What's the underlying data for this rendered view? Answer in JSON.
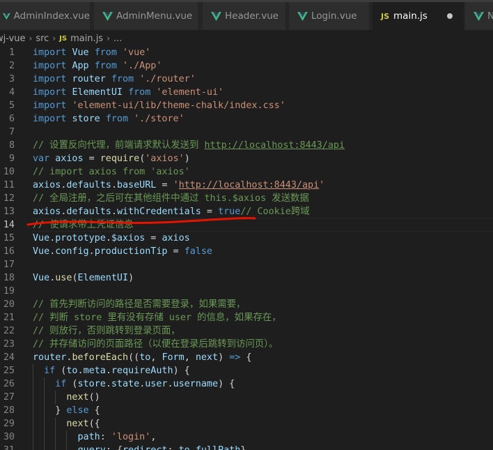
{
  "tabs": [
    {
      "label": "AdminIndex.vue",
      "icon": "vue-icon"
    },
    {
      "label": "AdminMenu.vue",
      "icon": "vue-icon"
    },
    {
      "label": "Header.vue",
      "icon": "vue-icon"
    },
    {
      "label": "Login.vue",
      "icon": "vue-icon"
    },
    {
      "label": "main.js",
      "icon": "js-icon",
      "active": true,
      "unsaved": true
    },
    {
      "label": "Nav",
      "icon": "vue-icon"
    }
  ],
  "js_badge": "JS",
  "breadcrumb": {
    "project": "wj-vue",
    "folder": "src",
    "file": "main.js",
    "more": "..."
  },
  "annotation": {
    "color": "#e51400",
    "description": "red hand-drawn underline under line 13"
  },
  "colors": {
    "keyword": "#569cd6",
    "string": "#ce9178",
    "comment": "#6a9955",
    "variable": "#9cdcfe",
    "function": "#dcdcaa",
    "plain": "#d4d4d4",
    "vue_icon": "#41b883"
  },
  "lines": [
    {
      "n": "1",
      "tokens": [
        [
          "import",
          "k"
        ],
        [
          " ",
          "p"
        ],
        [
          "Vue",
          "v"
        ],
        [
          " ",
          "p"
        ],
        [
          "from",
          "k"
        ],
        [
          " ",
          "p"
        ],
        [
          "'vue'",
          "s"
        ]
      ]
    },
    {
      "n": "2",
      "tokens": [
        [
          "import",
          "k"
        ],
        [
          " ",
          "p"
        ],
        [
          "App",
          "v"
        ],
        [
          " ",
          "p"
        ],
        [
          "from",
          "k"
        ],
        [
          " ",
          "p"
        ],
        [
          "'./App'",
          "s"
        ]
      ]
    },
    {
      "n": "3",
      "tokens": [
        [
          "import",
          "k"
        ],
        [
          " ",
          "p"
        ],
        [
          "router",
          "v"
        ],
        [
          " ",
          "p"
        ],
        [
          "from",
          "k"
        ],
        [
          " ",
          "p"
        ],
        [
          "'./router'",
          "s"
        ]
      ]
    },
    {
      "n": "4",
      "tokens": [
        [
          "import",
          "k"
        ],
        [
          " ",
          "p"
        ],
        [
          "ElementUI",
          "v"
        ],
        [
          " ",
          "p"
        ],
        [
          "from",
          "k"
        ],
        [
          " ",
          "p"
        ],
        [
          "'element-ui'",
          "s"
        ]
      ]
    },
    {
      "n": "5",
      "tokens": [
        [
          "import",
          "k"
        ],
        [
          " ",
          "p"
        ],
        [
          "'element-ui/lib/theme-chalk/index.css'",
          "s"
        ]
      ]
    },
    {
      "n": "6",
      "tokens": [
        [
          "import",
          "k"
        ],
        [
          " ",
          "p"
        ],
        [
          "store",
          "v"
        ],
        [
          " ",
          "p"
        ],
        [
          "from",
          "k"
        ],
        [
          " ",
          "p"
        ],
        [
          "'./store'",
          "s"
        ]
      ]
    },
    {
      "n": "7",
      "tokens": []
    },
    {
      "n": "8",
      "tokens": [
        [
          "// 设置反向代理，前端请求默认发送到 ",
          "c"
        ],
        [
          "http://localhost:8443/api",
          "c u"
        ]
      ]
    },
    {
      "n": "9",
      "tokens": [
        [
          "var",
          "k"
        ],
        [
          " ",
          "p"
        ],
        [
          "axios",
          "v"
        ],
        [
          " = ",
          "p"
        ],
        [
          "require",
          "f"
        ],
        [
          "(",
          "p"
        ],
        [
          "'axios'",
          "s"
        ],
        [
          ")",
          "p"
        ]
      ]
    },
    {
      "n": "10",
      "tokens": [
        [
          "// import axios from 'axios'",
          "c"
        ]
      ]
    },
    {
      "n": "11",
      "tokens": [
        [
          "axios",
          "v"
        ],
        [
          ".",
          "p"
        ],
        [
          "defaults",
          "v"
        ],
        [
          ".",
          "p"
        ],
        [
          "baseURL",
          "v"
        ],
        [
          " = ",
          "p"
        ],
        [
          "'",
          "s"
        ],
        [
          "http://localhost:8443/api",
          "s u"
        ],
        [
          "'",
          "s"
        ]
      ]
    },
    {
      "n": "12",
      "tokens": [
        [
          "// 全局注册，之后可在其他组件中通过 this.$axios 发送数据",
          "c"
        ]
      ]
    },
    {
      "n": "13",
      "tokens": [
        [
          "axios",
          "v"
        ],
        [
          ".",
          "p"
        ],
        [
          "defaults",
          "v"
        ],
        [
          ".",
          "p"
        ],
        [
          "withCredentials",
          "v"
        ],
        [
          " = ",
          "p"
        ],
        [
          "true",
          "k"
        ],
        [
          "// Cookie跨域",
          "c"
        ]
      ]
    },
    {
      "n": "14",
      "current": true,
      "tokens": [
        [
          "// 使请求带上凭证信息",
          "c"
        ]
      ]
    },
    {
      "n": "15",
      "tokens": [
        [
          "Vue",
          "v"
        ],
        [
          ".",
          "p"
        ],
        [
          "prototype",
          "v"
        ],
        [
          ".",
          "p"
        ],
        [
          "$axios",
          "v"
        ],
        [
          " = ",
          "p"
        ],
        [
          "axios",
          "v"
        ]
      ]
    },
    {
      "n": "16",
      "tokens": [
        [
          "Vue",
          "v"
        ],
        [
          ".",
          "p"
        ],
        [
          "config",
          "v"
        ],
        [
          ".",
          "p"
        ],
        [
          "productionTip",
          "v"
        ],
        [
          " = ",
          "p"
        ],
        [
          "false",
          "k"
        ]
      ]
    },
    {
      "n": "17",
      "tokens": []
    },
    {
      "n": "18",
      "tokens": [
        [
          "Vue",
          "v"
        ],
        [
          ".",
          "p"
        ],
        [
          "use",
          "f"
        ],
        [
          "(",
          "p"
        ],
        [
          "ElementUI",
          "v"
        ],
        [
          ")",
          "p"
        ]
      ]
    },
    {
      "n": "19",
      "tokens": []
    },
    {
      "n": "20",
      "tokens": [
        [
          "// 首先判断访问的路径是否需要登录，如果需要，",
          "c"
        ]
      ]
    },
    {
      "n": "21",
      "tokens": [
        [
          "// 判断 store 里有没有存储 user 的信息，如果存在，",
          "c"
        ]
      ]
    },
    {
      "n": "22",
      "tokens": [
        [
          "// 则放行，否则跳转到登录页面，",
          "c"
        ]
      ]
    },
    {
      "n": "23",
      "tokens": [
        [
          "// 并存储访问的页面路径（以便在登录后跳转到访问页）。",
          "c"
        ]
      ]
    },
    {
      "n": "24",
      "tokens": [
        [
          "router",
          "v"
        ],
        [
          ".",
          "p"
        ],
        [
          "beforeEach",
          "f"
        ],
        [
          "((",
          "p"
        ],
        [
          "to",
          "v"
        ],
        [
          ", ",
          "p"
        ],
        [
          "Form",
          "v"
        ],
        [
          ", ",
          "p"
        ],
        [
          "next",
          "v"
        ],
        [
          ") ",
          "p"
        ],
        [
          "=>",
          "k"
        ],
        [
          " {",
          "p"
        ]
      ]
    },
    {
      "n": "25",
      "tokens": [
        [
          "  ",
          "p"
        ],
        [
          "if",
          "k"
        ],
        [
          " (",
          "p"
        ],
        [
          "to",
          "v"
        ],
        [
          ".",
          "p"
        ],
        [
          "meta",
          "v"
        ],
        [
          ".",
          "p"
        ],
        [
          "requireAuth",
          "v"
        ],
        [
          ") {",
          "p"
        ]
      ]
    },
    {
      "n": "26",
      "tokens": [
        [
          "    ",
          "p"
        ],
        [
          "if",
          "k"
        ],
        [
          " (",
          "p"
        ],
        [
          "store",
          "v"
        ],
        [
          ".",
          "p"
        ],
        [
          "state",
          "v"
        ],
        [
          ".",
          "p"
        ],
        [
          "user",
          "v"
        ],
        [
          ".",
          "p"
        ],
        [
          "username",
          "v"
        ],
        [
          ") {",
          "p"
        ]
      ]
    },
    {
      "n": "27",
      "tokens": [
        [
          "      ",
          "p"
        ],
        [
          "next",
          "f"
        ],
        [
          "()",
          "p"
        ]
      ]
    },
    {
      "n": "28",
      "tokens": [
        [
          "    } ",
          "p"
        ],
        [
          "else",
          "k"
        ],
        [
          " {",
          "p"
        ]
      ]
    },
    {
      "n": "29",
      "tokens": [
        [
          "      ",
          "p"
        ],
        [
          "next",
          "f"
        ],
        [
          "({",
          "p"
        ]
      ]
    },
    {
      "n": "30",
      "tokens": [
        [
          "        ",
          "p"
        ],
        [
          "path",
          "v"
        ],
        [
          ": ",
          "p"
        ],
        [
          "'login'",
          "s"
        ],
        [
          ",",
          "p"
        ]
      ]
    },
    {
      "n": "31",
      "tokens": [
        [
          "        ",
          "p"
        ],
        [
          "query",
          "v"
        ],
        [
          ": {",
          "p"
        ],
        [
          "redirect",
          "v"
        ],
        [
          ": ",
          "p"
        ],
        [
          "to",
          "v"
        ],
        [
          ".",
          "p"
        ],
        [
          "fullPath",
          "v"
        ],
        [
          "}",
          "p"
        ]
      ]
    }
  ]
}
